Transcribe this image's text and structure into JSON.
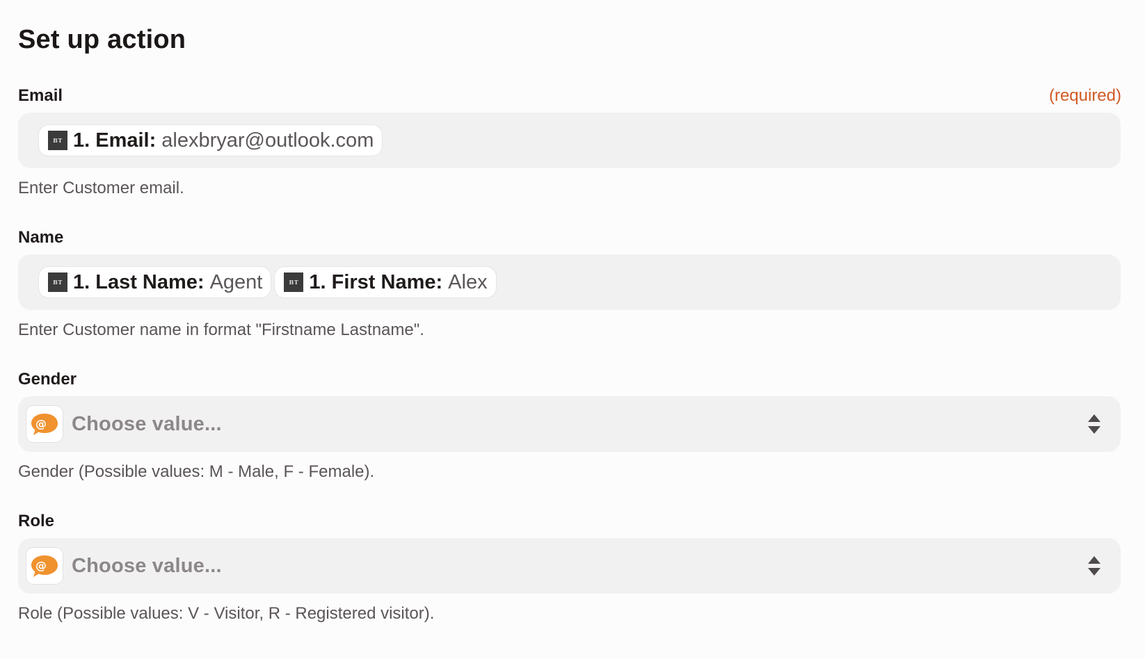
{
  "header": {
    "title": "Set up action"
  },
  "fields": {
    "email": {
      "label": "Email",
      "required_text": "(required)",
      "pill": {
        "icon_text": "BT",
        "key": "1. Email:",
        "value": "alexbryar@outlook.com"
      },
      "help": "Enter Customer email."
    },
    "name": {
      "label": "Name",
      "pills": [
        {
          "icon_text": "BT",
          "key": "1. Last Name:",
          "value": "Agent"
        },
        {
          "icon_text": "BT",
          "key": "1. First Name:",
          "value": "Alex"
        }
      ],
      "help": "Enter Customer name in format \"Firstname Lastname\"."
    },
    "gender": {
      "label": "Gender",
      "placeholder": "Choose value...",
      "help": "Gender (Possible values: M - Male, F - Female)."
    },
    "role": {
      "label": "Role",
      "placeholder": "Choose value...",
      "help": "Role (Possible values: V - Visitor, R - Registered visitor)."
    }
  },
  "icons": {
    "pill_icon": "bt-app-icon",
    "select_icon": "chat-bubble-at-icon",
    "select_arrow": "updown-arrow-icon"
  },
  "colors": {
    "required": "#d05a24",
    "field_bg": "#f2f1f2",
    "accent_orange": "#f0922e"
  }
}
